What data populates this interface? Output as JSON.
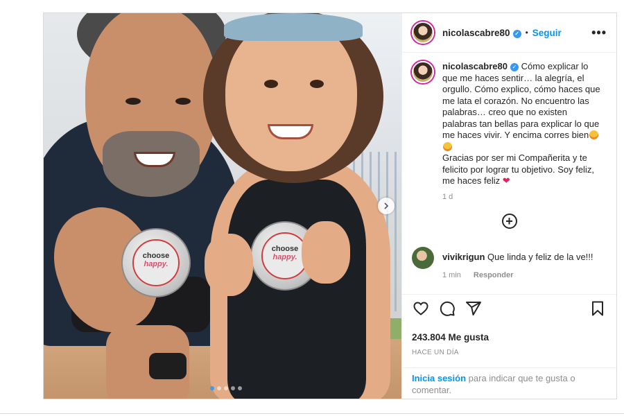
{
  "header": {
    "username": "nicolascabre80",
    "separator": "•",
    "follow_label": "Seguir",
    "more_label": "•••"
  },
  "caption": {
    "username": "nicolascabre80",
    "text_part1": "Cómo explicar lo que me haces sentir… la alegría, el orgullo. Cómo explico, cómo haces que me lata el corazón. No encuentro las palabras… creo que no existen palabras tan bellas para explicar lo que me haces vivir. Y encima corres bien",
    "text_part2": "Gracias por ser mi Compañerita y te felicito por lograr tu objetivo. Soy feliz, me haces feliz",
    "age": "1 d"
  },
  "comment": {
    "username": "vivikrigun",
    "text": "Que linda y feliz de la ve!!!",
    "age": "1 min",
    "reply_label": "Responder"
  },
  "actions": {
    "like_icon": "heart-outline-icon",
    "comment_icon": "comment-bubble-icon",
    "share_icon": "paper-plane-icon",
    "save_icon": "bookmark-icon"
  },
  "likes": "243.804 Me gusta",
  "timestamp": "HACE UN DÍA",
  "login": {
    "link": "Inicia sesión",
    "rest": " para indicar que te gusta o comentar."
  },
  "medal": {
    "line1": "choose",
    "line2": "happy."
  },
  "carousel": {
    "slides": 5,
    "active_index": 0
  },
  "colors": {
    "link_blue": "#0095f6",
    "verified_blue": "#3897f0",
    "heart_red": "#e0245e",
    "meta_gray": "#8e8e8e"
  }
}
